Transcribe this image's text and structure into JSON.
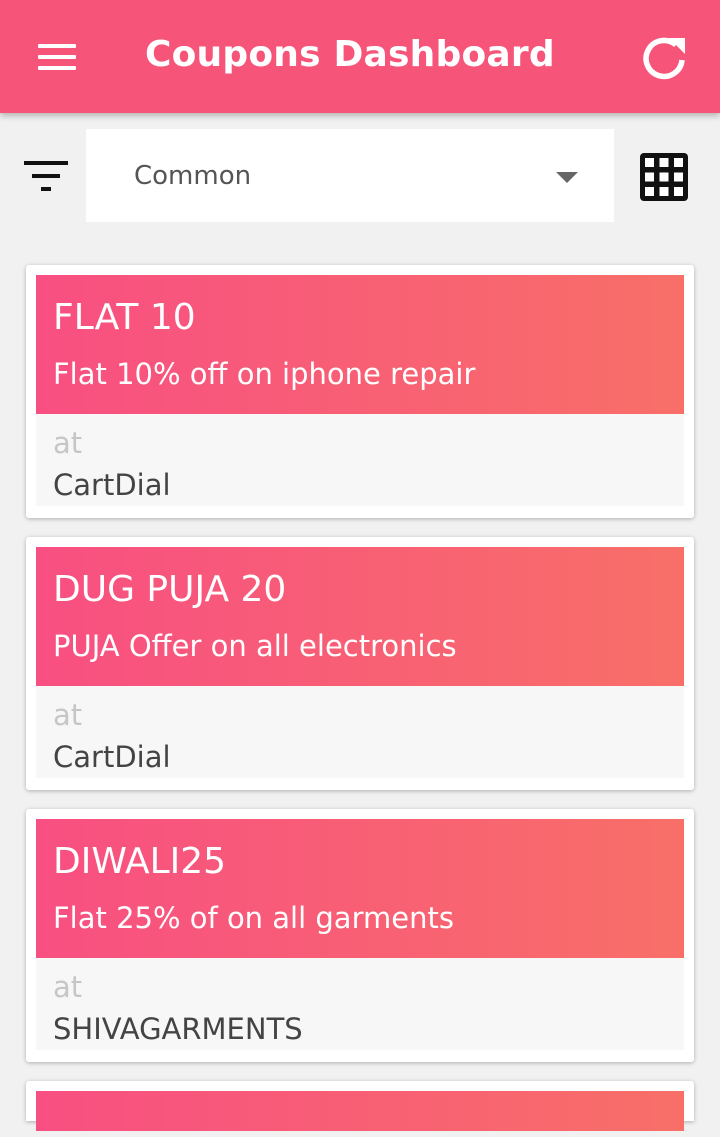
{
  "app_bar": {
    "title": "Coupons Dashboard",
    "menu_icon": "hamburger-menu-icon",
    "refresh_icon": "refresh-icon",
    "color": "#f7547a"
  },
  "filter": {
    "filter_icon": "filter-icon",
    "selected_category": "Common",
    "grid_icon": "grid-view-icon"
  },
  "coupons": [
    {
      "code": "FLAT 10",
      "description": "Flat 10% off on iphone repair",
      "at_label": "at",
      "store": "CartDial"
    },
    {
      "code": "DUG PUJA 20",
      "description": "PUJA Offer on all electronics",
      "at_label": "at",
      "store": "CartDial"
    },
    {
      "code": "DIWALI25",
      "description": "Flat 25% of on all garments",
      "at_label": "at",
      "store": "SHIVAGARMENTS"
    }
  ],
  "colors": {
    "gradient_start": "#f84f82",
    "gradient_end": "#f86f68",
    "background": "#f1f1f1"
  }
}
